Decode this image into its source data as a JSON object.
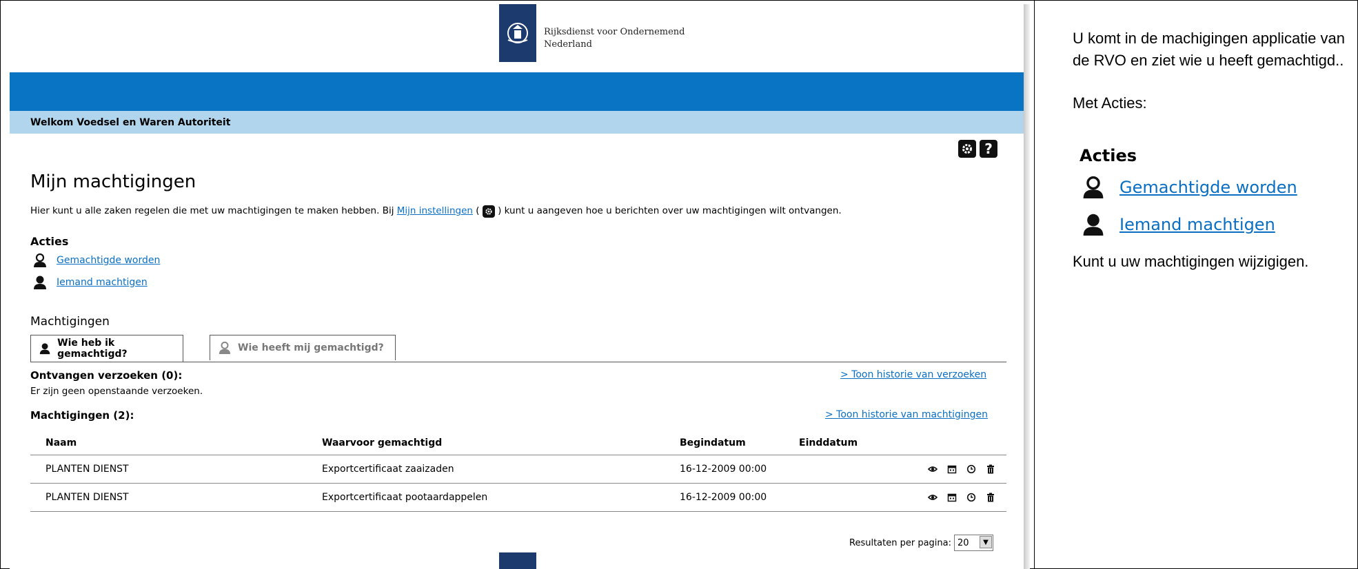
{
  "header": {
    "org_line1": "Rijksdienst voor Ondernemend",
    "org_line2": "Nederland",
    "welcome": "Welkom Voedsel en Waren Autoriteit"
  },
  "page": {
    "title": "Mijn machtigingen",
    "intro_before": "Hier kunt u alle zaken regelen die met uw machtigingen te maken hebben. Bij ",
    "intro_link": "Mijn instellingen",
    "intro_after": " kunt u aangeven hoe u berichten over uw machtigingen wilt ontvangen.",
    "acties_title": "Acties",
    "action_1": "Gemachtigde worden",
    "action_2": "Iemand machtigen",
    "machtigingen_title": "Machtigingen",
    "tab_1": "Wie heb ik gemachtigd?",
    "tab_2": "Wie heeft mij gemachtigd?",
    "received_title": "Ontvangen verzoeken (0):",
    "received_note": "Er zijn geen openstaande verzoeken.",
    "received_history": "> Toon historie van verzoeken",
    "grants_title": "Machtigingen (2):",
    "grants_history": "> Toon historie van machtigingen"
  },
  "table": {
    "columns": [
      "Naam",
      "Waarvoor gemachtigd",
      "Begindatum",
      "Einddatum"
    ],
    "rows": [
      [
        "PLANTEN DIENST",
        "Exportcertificaat zaaizaden",
        "16-12-2009 00:00",
        ""
      ],
      [
        "PLANTEN DIENST",
        "Exportcertificaat pootaardappelen",
        "16-12-2009 00:00",
        ""
      ]
    ]
  },
  "pagination": {
    "label": "Resultaten per pagina:",
    "value": "20"
  },
  "annotation": {
    "p1": "U komt in de machigingen applicatie van de RVO en ziet wie u heeft gemachtigd..",
    "p2": "Met  Acties:",
    "acties": "Acties",
    "action_1": "Gemachtigde worden",
    "action_2": "Iemand machtigen",
    "p3": "Kunt u uw machtigingen wijzigigen."
  },
  "colors": {
    "primary_blue": "#0a74c4",
    "light_blue": "#b2d5ee",
    "logo_navy": "#1c3a6e",
    "link": "#0a6fc2"
  }
}
